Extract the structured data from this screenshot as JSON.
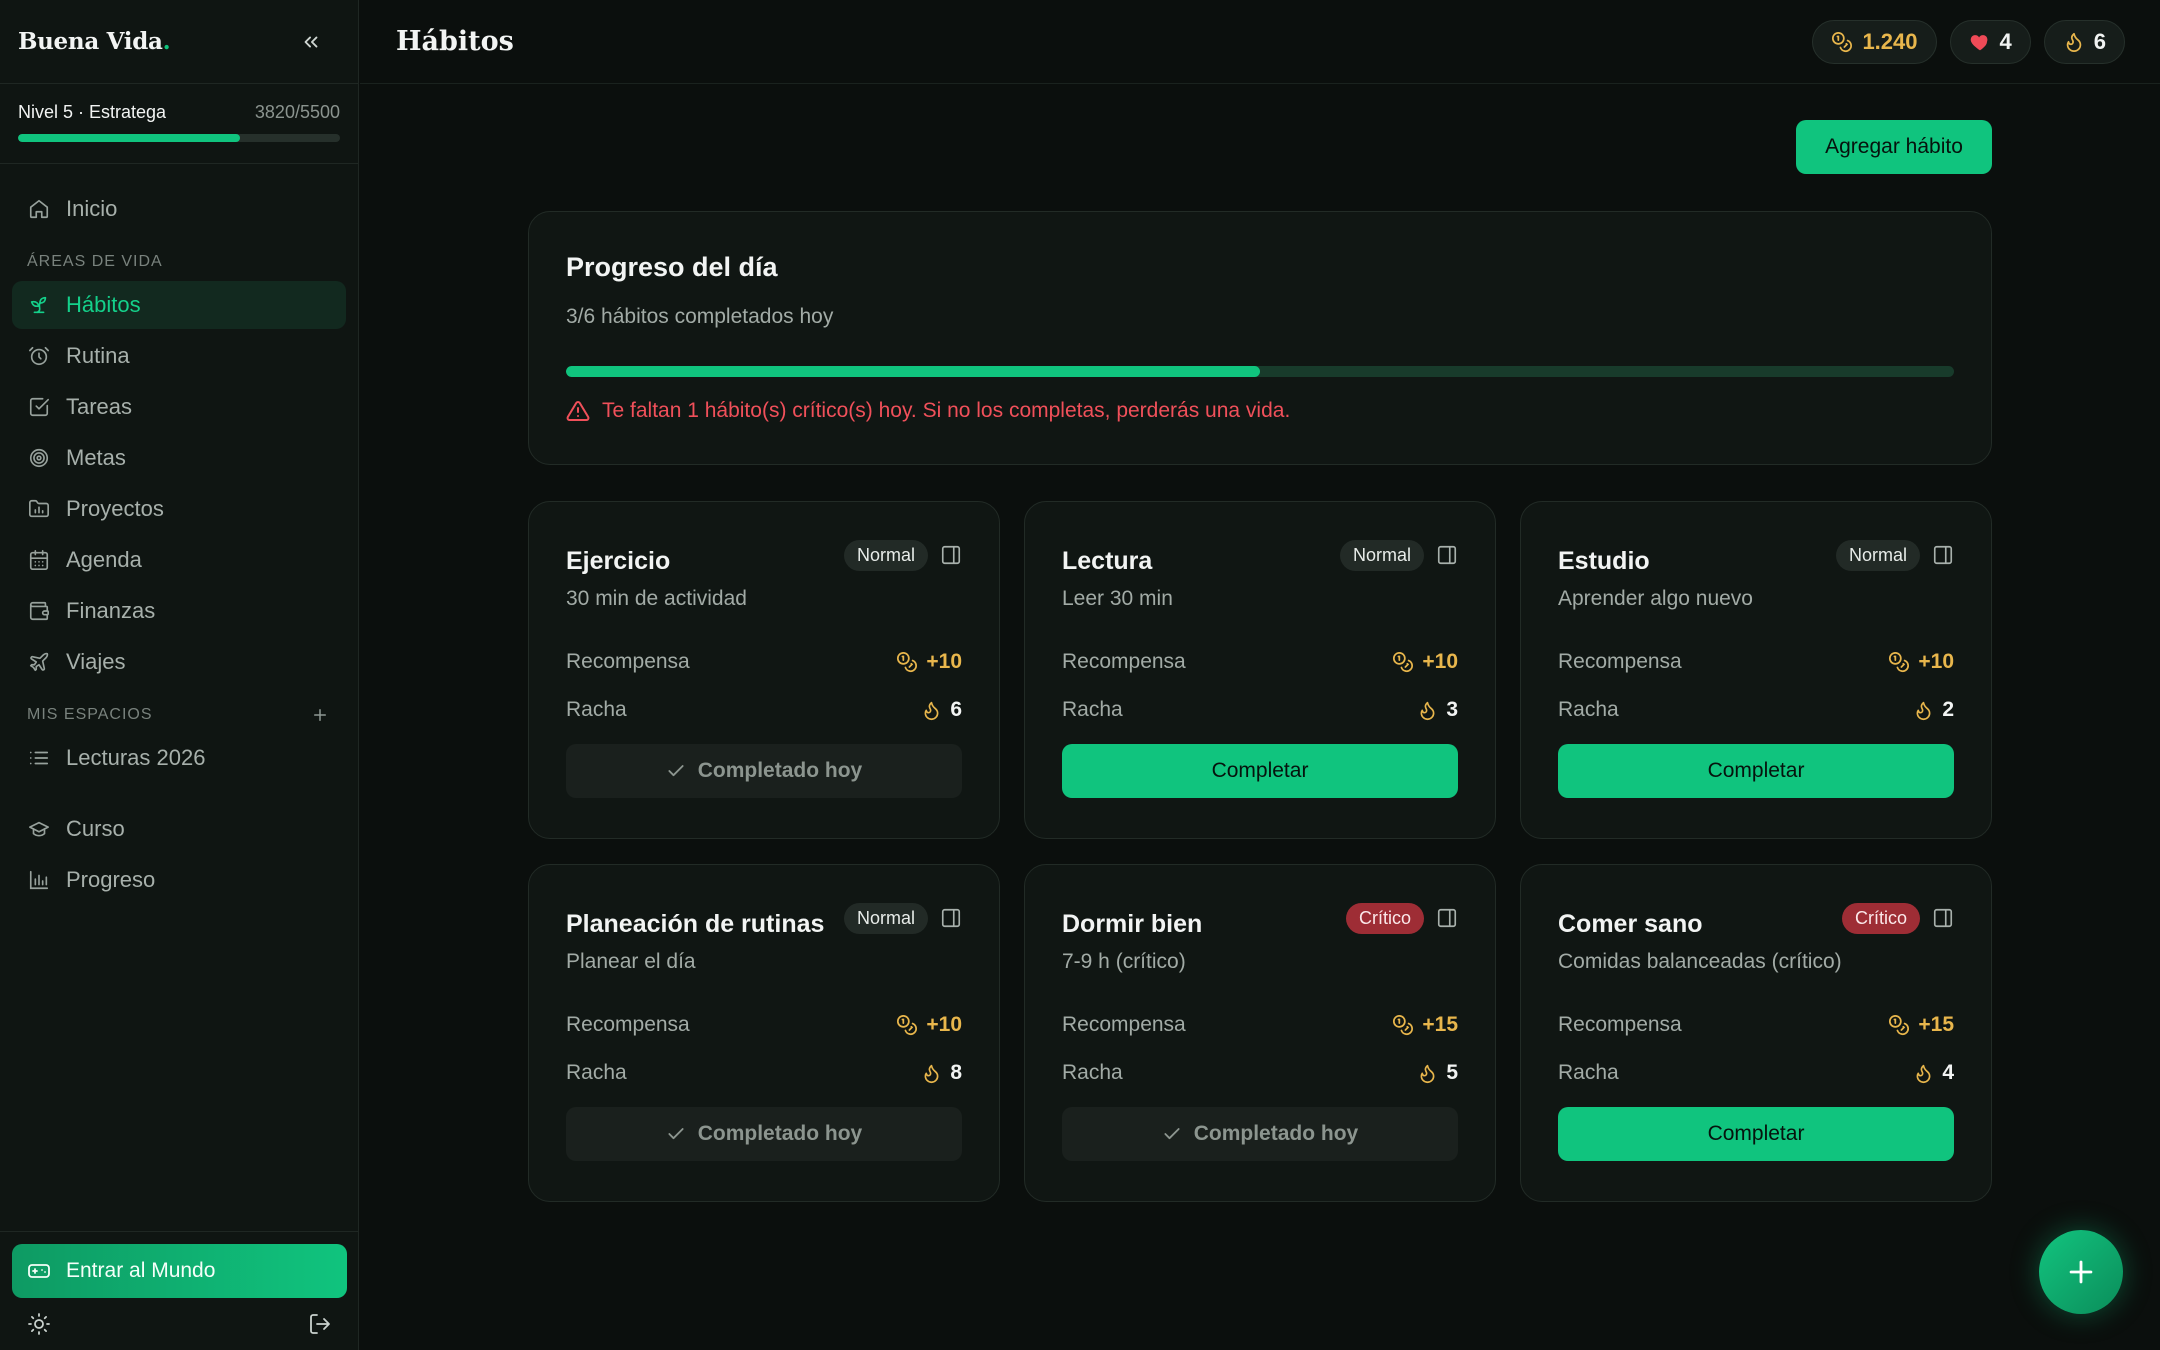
{
  "brand": {
    "name": "Buena Vida",
    "dot": "."
  },
  "level": {
    "label": "Nivel 5 · Estratega",
    "xp_text": "3820/5500",
    "progress_fraction": 0.69
  },
  "nav": {
    "home": "Inicio",
    "areas_label": "ÁREAS DE VIDA",
    "areas": [
      {
        "label": "Hábitos",
        "icon": "sprout-icon",
        "active": true
      },
      {
        "label": "Rutina",
        "icon": "alarm-clock-icon"
      },
      {
        "label": "Tareas",
        "icon": "checkbox-icon"
      },
      {
        "label": "Metas",
        "icon": "target-icon"
      },
      {
        "label": "Proyectos",
        "icon": "folder-chart-icon"
      },
      {
        "label": "Agenda",
        "icon": "calendar-icon"
      },
      {
        "label": "Finanzas",
        "icon": "wallet-icon"
      },
      {
        "label": "Viajes",
        "icon": "plane-icon"
      }
    ],
    "spaces_label": "MIS ESPACIOS",
    "spaces": [
      {
        "label": "Lecturas 2026",
        "icon": "list-icon"
      }
    ],
    "extra": [
      {
        "label": "Curso",
        "icon": "graduation-cap-icon"
      },
      {
        "label": "Progreso",
        "icon": "bar-chart-icon"
      }
    ],
    "world_button": "Entrar al Mundo"
  },
  "header": {
    "title": "Hábitos",
    "stats": {
      "coins": "1.240",
      "hearts": "4",
      "streak": "6"
    }
  },
  "add_habit_label": "Agregar hábito",
  "progress": {
    "title": "Progreso del día",
    "subtitle": "3/6 hábitos completados hoy",
    "fraction": 0.5,
    "warning": "Te faltan 1 hábito(s) crítico(s) hoy. Si no los completas, perderás una vida."
  },
  "habit_labels": {
    "reward": "Recompensa",
    "streak": "Racha",
    "complete": "Completar",
    "done": "Completado hoy"
  },
  "habits": [
    {
      "name": "Ejercicio",
      "badge": "Normal",
      "critical": false,
      "desc": "30 min de actividad",
      "reward": "+10",
      "streak": "6",
      "done": true
    },
    {
      "name": "Lectura",
      "badge": "Normal",
      "critical": false,
      "desc": "Leer 30 min",
      "reward": "+10",
      "streak": "3",
      "done": false
    },
    {
      "name": "Estudio",
      "badge": "Normal",
      "critical": false,
      "desc": "Aprender algo nuevo",
      "reward": "+10",
      "streak": "2",
      "done": false
    },
    {
      "name": "Planeación de rutinas",
      "badge": "Normal",
      "critical": false,
      "desc": "Planear el día",
      "reward": "+10",
      "streak": "8",
      "done": true
    },
    {
      "name": "Dormir bien",
      "badge": "Crítico",
      "critical": true,
      "desc": "7-9 h (crítico)",
      "reward": "+15",
      "streak": "5",
      "done": true
    },
    {
      "name": "Comer sano",
      "badge": "Crítico",
      "critical": true,
      "desc": "Comidas balanceadas (crítico)",
      "reward": "+15",
      "streak": "4",
      "done": false
    }
  ],
  "colors": {
    "accent": "#10c47e",
    "coin": "#e8b64c",
    "danger": "#f0505a",
    "critical_badge": "#9e2d35",
    "background": "#0b0f0d"
  }
}
